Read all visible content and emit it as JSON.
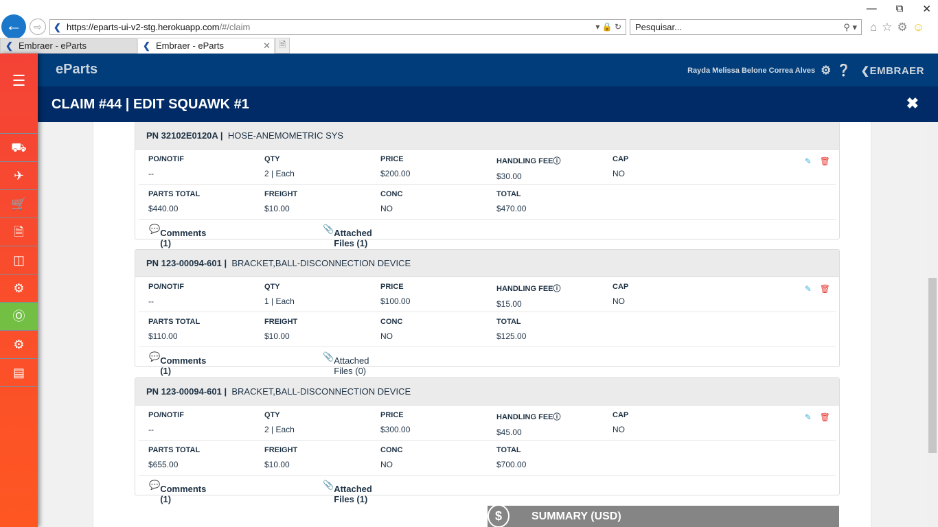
{
  "browser": {
    "url_main": "https://eparts-ui-v2-stg.herokuapp.com",
    "url_rest": "/#/claim",
    "search_placeholder": "Pesquisar...",
    "tabs": [
      {
        "label": "Embraer - eParts"
      },
      {
        "label": "Embraer - eParts"
      }
    ]
  },
  "app": {
    "brand": "eParts",
    "user": "Rayda Melissa Belone Correa Alves",
    "logo": "EMBRAER"
  },
  "sidebar": {
    "items": [
      "menu-icon",
      "truck-icon",
      "plane-icon",
      "cart-icon",
      "document-icon",
      "box-return-icon",
      "gear-exchange-icon",
      "dollar-refresh-icon",
      "gears-icon",
      "chart-icon"
    ],
    "active": "dollar-refresh-icon"
  },
  "title": "CLAIM #44 | EDIT SQUAWK #1",
  "labels": {
    "po": "PO/NOTIF",
    "qty": "QTY",
    "price": "PRICE",
    "handling": "HANDLING FEE",
    "cap": "CAP",
    "parts_total": "PARTS TOTAL",
    "freight": "FREIGHT",
    "conc": "CONC",
    "total": "TOTAL"
  },
  "parts": [
    {
      "pn": "PN 32102E0120A |",
      "desc": "HOSE-ANEMOMETRIC SYS",
      "po": "--",
      "qty": "2 | Each",
      "price": "$200.00",
      "handling": "$30.00",
      "cap": "NO",
      "parts_total": "$440.00",
      "freight": "$10.00",
      "conc": "NO",
      "total": "$470.00",
      "comments": "Comments (1)",
      "files": "Attached Files (1)"
    },
    {
      "pn": "PN 123-00094-601 |",
      "desc": "BRACKET,BALL-DISCONNECTION DEVICE",
      "po": "--",
      "qty": "1 | Each",
      "price": "$100.00",
      "handling": "$15.00",
      "cap": "NO",
      "parts_total": "$110.00",
      "freight": "$10.00",
      "conc": "NO",
      "total": "$125.00",
      "comments": "Comments (1)",
      "files": "Attached Files (0)"
    },
    {
      "pn": "PN 123-00094-601 |",
      "desc": "BRACKET,BALL-DISCONNECTION DEVICE",
      "po": "--",
      "qty": "2 | Each",
      "price": "$300.00",
      "handling": "$45.00",
      "cap": "NO",
      "parts_total": "$655.00",
      "freight": "$10.00",
      "conc": "NO",
      "total": "$700.00",
      "comments": "Comments (1)",
      "files": "Attached Files (1)"
    }
  ],
  "summary": "SUMMARY (USD)"
}
